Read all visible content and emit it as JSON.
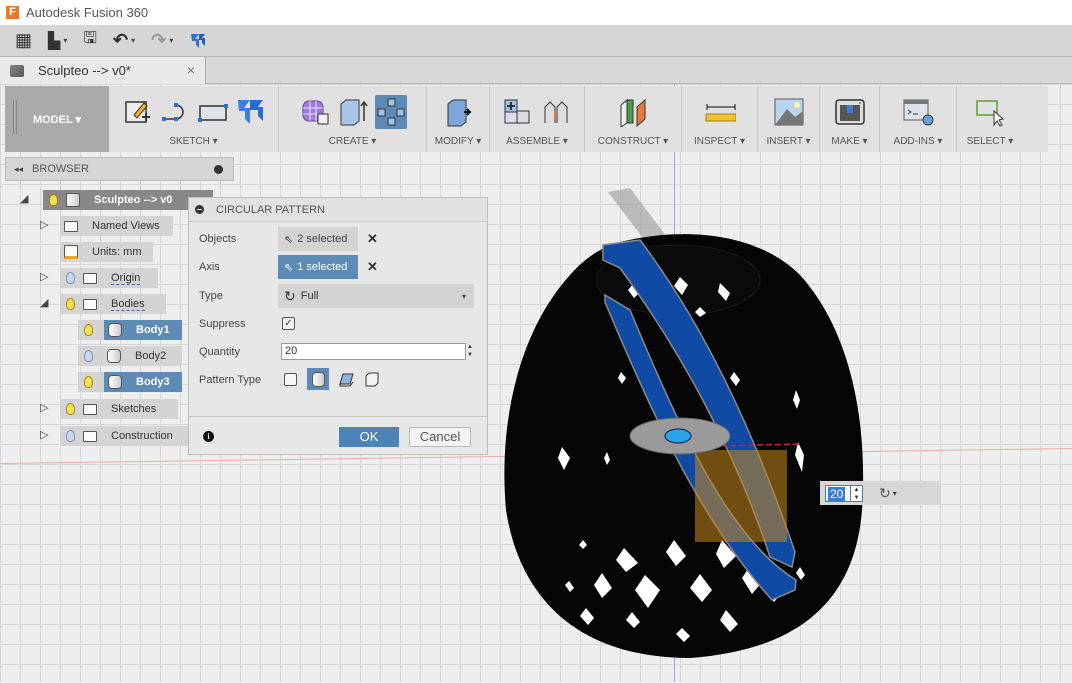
{
  "app": {
    "title": "Autodesk Fusion 360",
    "logo_letter": "F"
  },
  "quick_access": {
    "items": [
      {
        "name": "data-panel-icon",
        "glyph": "▦"
      },
      {
        "name": "file-icon",
        "glyph": "▙",
        "caret": "▾"
      },
      {
        "name": "save-icon",
        "glyph": "🖫"
      },
      {
        "name": "undo-icon",
        "glyph": "↶",
        "caret": "▾"
      },
      {
        "name": "redo-icon",
        "glyph": "↷",
        "caret": "▾"
      },
      {
        "name": "sculptor-icon",
        "glyph": "⯌"
      }
    ]
  },
  "document_tab": {
    "label": "Sculpteo --> v0*",
    "close": "×"
  },
  "ribbon": {
    "workspace": "MODEL ▾",
    "groups": [
      {
        "label": "SKETCH ▾",
        "tools": [
          "create-sketch-icon",
          "arc-icon",
          "rectangle-icon",
          "finish-sketch-icon"
        ]
      },
      {
        "label": "CREATE ▾",
        "tools": [
          "create-form-icon",
          "extrude-icon",
          "pattern-icon"
        ]
      },
      {
        "label": "MODIFY ▾",
        "tools": [
          "press-pull-icon"
        ]
      },
      {
        "label": "ASSEMBLE ▾",
        "tools": [
          "new-component-icon",
          "joint-icon"
        ]
      },
      {
        "label": "CONSTRUCT ▾",
        "tools": [
          "offset-plane-icon"
        ]
      },
      {
        "label": "INSPECT ▾",
        "tools": [
          "measure-icon"
        ]
      },
      {
        "label": "INSERT ▾",
        "tools": [
          "insert-image-icon"
        ]
      },
      {
        "label": "MAKE ▾",
        "tools": [
          "3d-print-icon"
        ]
      },
      {
        "label": "ADD-INS ▾",
        "tools": [
          "scripts-icon"
        ]
      },
      {
        "label": "SELECT ▾",
        "tools": [
          "select-icon"
        ]
      }
    ]
  },
  "browser": {
    "title": "BROWSER",
    "rewind": "◂◂",
    "root": "Sculpteo --> v0",
    "items": [
      {
        "label": "Named Views"
      },
      {
        "label": "Units: mm"
      },
      {
        "label": "Origin"
      },
      {
        "label": "Bodies"
      },
      {
        "label": "Body1"
      },
      {
        "label": "Body2"
      },
      {
        "label": "Body3"
      },
      {
        "label": "Sketches"
      },
      {
        "label": "Construction"
      }
    ]
  },
  "dialog": {
    "title": "CIRCULAR PATTERN",
    "objects_label": "Objects",
    "objects_value": "2 selected",
    "axis_label": "Axis",
    "axis_value": "1 selected",
    "type_label": "Type",
    "type_value": "Full",
    "suppress_label": "Suppress",
    "suppress_checked": "✓",
    "quantity_label": "Quantity",
    "quantity_value": "20",
    "pattern_type_label": "Pattern Type",
    "clear": "✕",
    "info": "i",
    "ok": "OK",
    "cancel": "Cancel"
  },
  "viewport": {
    "quantity_inline": "20",
    "type_glyph": "↻",
    "caret": "▾"
  },
  "colors": {
    "accent": "#5d8bb6",
    "ok_button": "#4d84b7",
    "selected_body": "#0a3d91",
    "manipulator_box": "#c8881a"
  }
}
